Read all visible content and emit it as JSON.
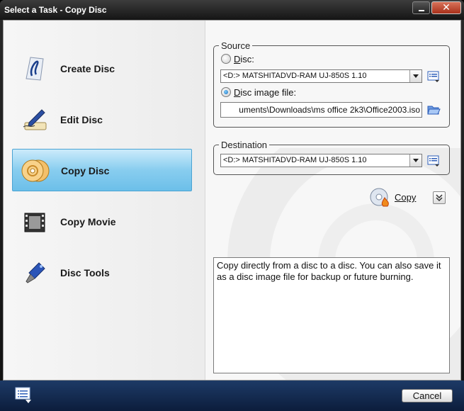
{
  "window": {
    "title": "Select a Task - Copy Disc"
  },
  "tasks": [
    {
      "label": "Create Disc",
      "icon": "create-disc-icon",
      "selected": false
    },
    {
      "label": "Edit Disc",
      "icon": "edit-disc-icon",
      "selected": false
    },
    {
      "label": "Copy Disc",
      "icon": "copy-disc-icon",
      "selected": true
    },
    {
      "label": "Copy Movie",
      "icon": "copy-movie-icon",
      "selected": false
    },
    {
      "label": "Disc Tools",
      "icon": "disc-tools-icon",
      "selected": false
    }
  ],
  "source": {
    "legend": "Source",
    "disc_label_prefix": "D",
    "disc_label_rest": "isc:",
    "disc_selected": false,
    "disc_drive": "<D:>  MATSHITADVD-RAM UJ-850S  1.10",
    "image_label_prefix": "D",
    "image_label_rest": "isc image file:",
    "image_selected": true,
    "image_path": "uments\\Downloads\\ms office 2k3\\Office2003.iso"
  },
  "destination": {
    "legend": "Destination",
    "drive": "<D:>  MATSHITADVD-RAM UJ-850S  1.10"
  },
  "actions": {
    "copy_label": "Copy"
  },
  "description": "Copy directly from a disc to a disc. You can also save it as a disc image file for backup or future burning.",
  "footer": {
    "cancel_label": "Cancel"
  },
  "colors": {
    "selected_task": "#88cdef",
    "titlebar": "#1a1a1a",
    "footer": "#163260"
  }
}
